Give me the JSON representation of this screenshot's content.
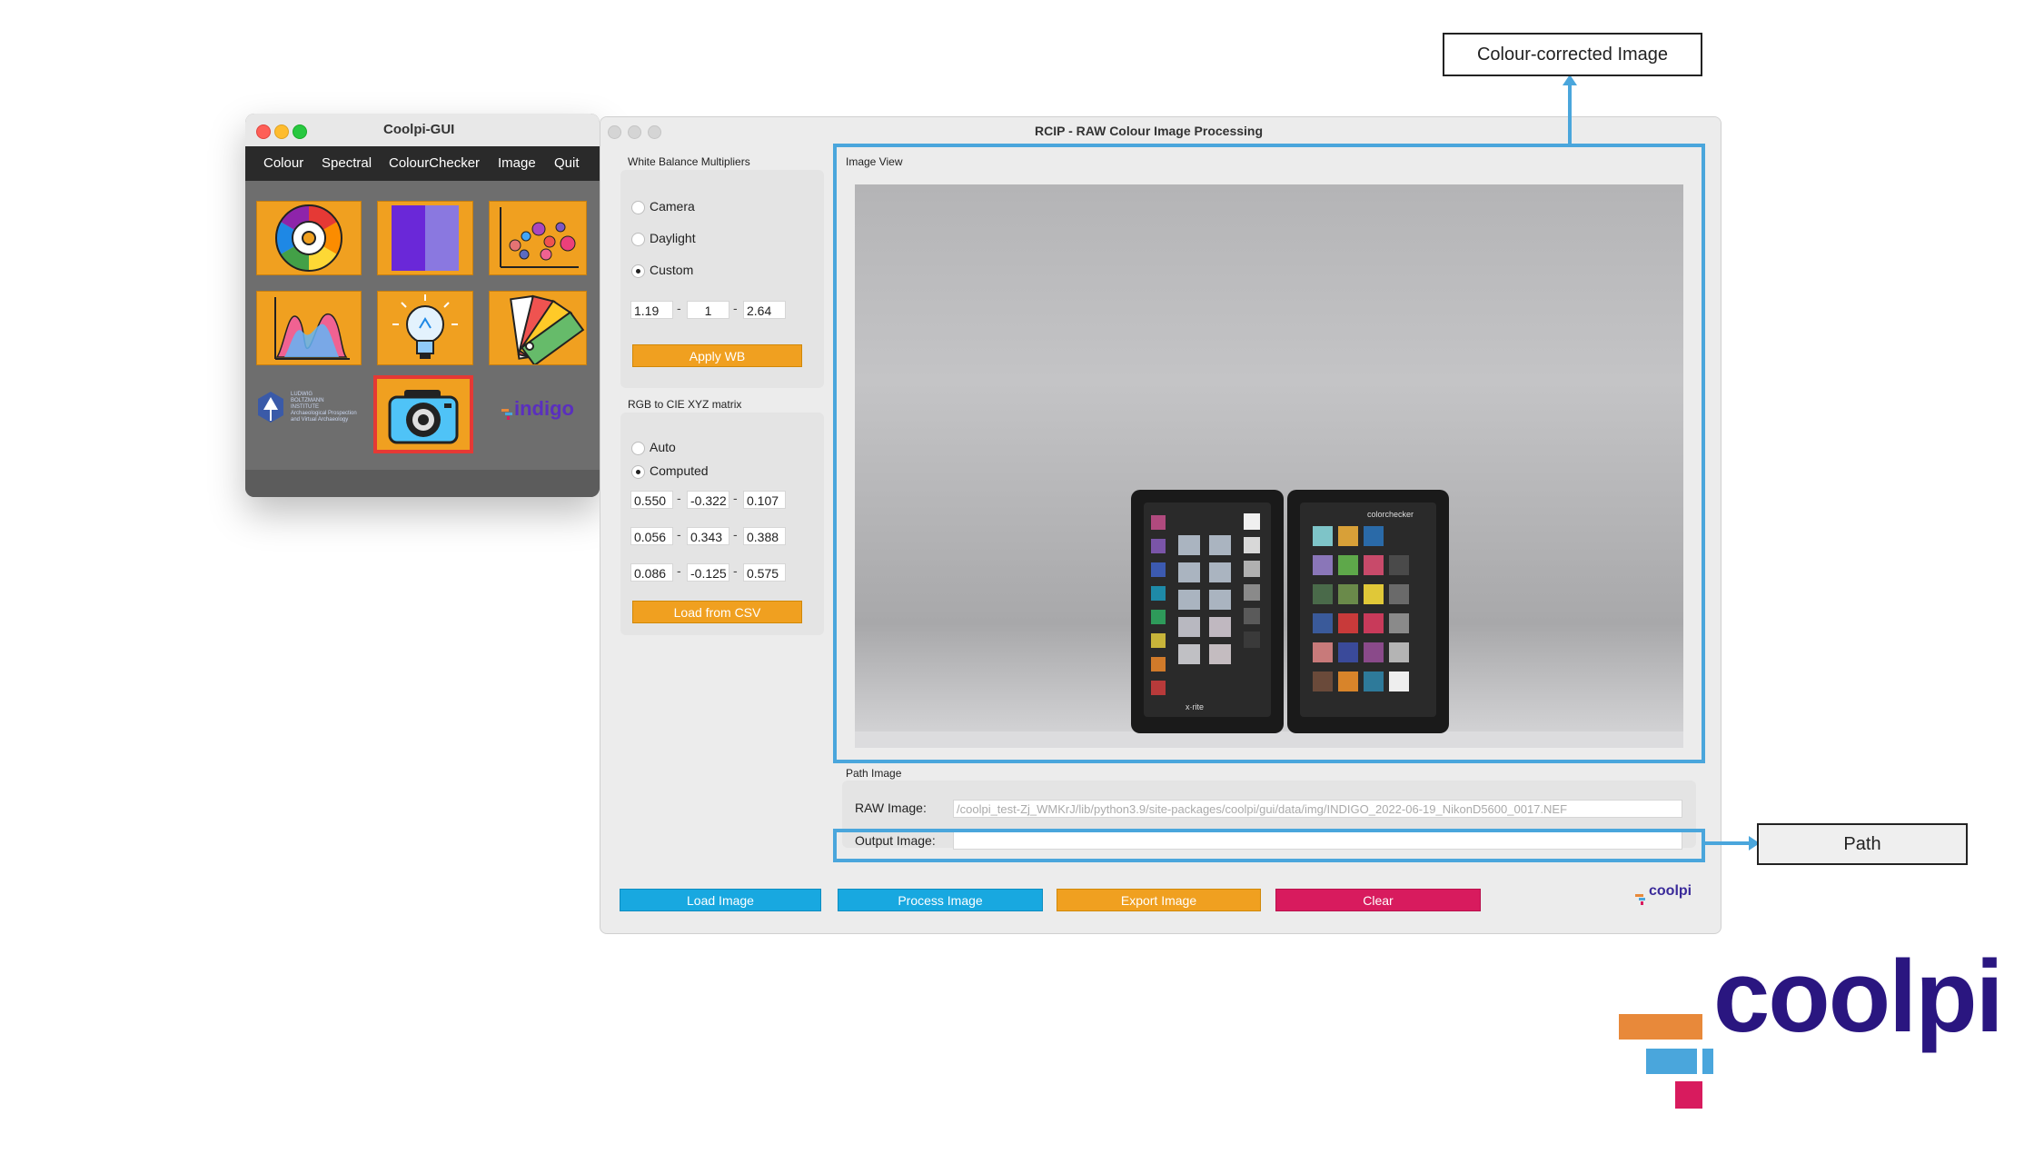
{
  "coolpi_gui": {
    "title": "Coolpi-GUI",
    "menu": [
      "Colour",
      "Spectral",
      "ColourChecker",
      "Image",
      "Quit"
    ],
    "tiles": [
      "colour-wheel-icon",
      "spectrum-icon",
      "scatter-icon",
      "spectral-curve-icon",
      "lightbulb-icon",
      "swatch-fan-icon"
    ],
    "logos": {
      "lbi_lines": [
        "LUDWIG",
        "BOLTZMANN",
        "INSTITUTE",
        "Archaeological Prospection",
        "and Virtual Archaeology"
      ],
      "indigo": "indigo"
    }
  },
  "rcip": {
    "title": "RCIP - RAW Colour Image Processing",
    "wb": {
      "label": "White Balance Multipliers",
      "options": [
        "Camera",
        "Daylight",
        "Custom"
      ],
      "selected": "Custom",
      "values": [
        "1.19",
        "1",
        "2.64"
      ],
      "apply_label": "Apply WB"
    },
    "matrix": {
      "label": "RGB to CIE XYZ matrix",
      "options": [
        "Auto",
        "Computed"
      ],
      "selected": "Computed",
      "rows": [
        [
          "0.550",
          "-0.322",
          "0.107"
        ],
        [
          "0.056",
          "0.343",
          "0.388"
        ],
        [
          "0.086",
          "-0.125",
          "0.575"
        ]
      ],
      "load_label": "Load from CSV"
    },
    "image_view": {
      "label": "Image View",
      "checker_brand_left": "x·rite",
      "checker_brand_right": "colorchecker"
    },
    "path": {
      "label": "Path Image",
      "raw_label": "RAW Image:",
      "raw_value": "/coolpi_test-Zj_WMKrJ/lib/python3.9/site-packages/coolpi/gui/data/img/INDIGO_2022-06-19_NikonD5600_0017.NEF",
      "output_label": "Output Image:",
      "output_value": ""
    },
    "buttons": {
      "load": "Load Image",
      "process": "Process Image",
      "export": "Export Image",
      "clear": "Clear"
    },
    "small_logo": "coolpi"
  },
  "annotations": {
    "colour_corrected": "Colour-corrected Image",
    "path": "Path"
  },
  "brand_logo": "coolpi",
  "colors": {
    "accent_orange": "#f0a020",
    "accent_blue": "#18a8e0",
    "accent_red": "#d81b5e",
    "highlight_blue": "#4aa6dc",
    "logo_purple": "#2a1680"
  }
}
